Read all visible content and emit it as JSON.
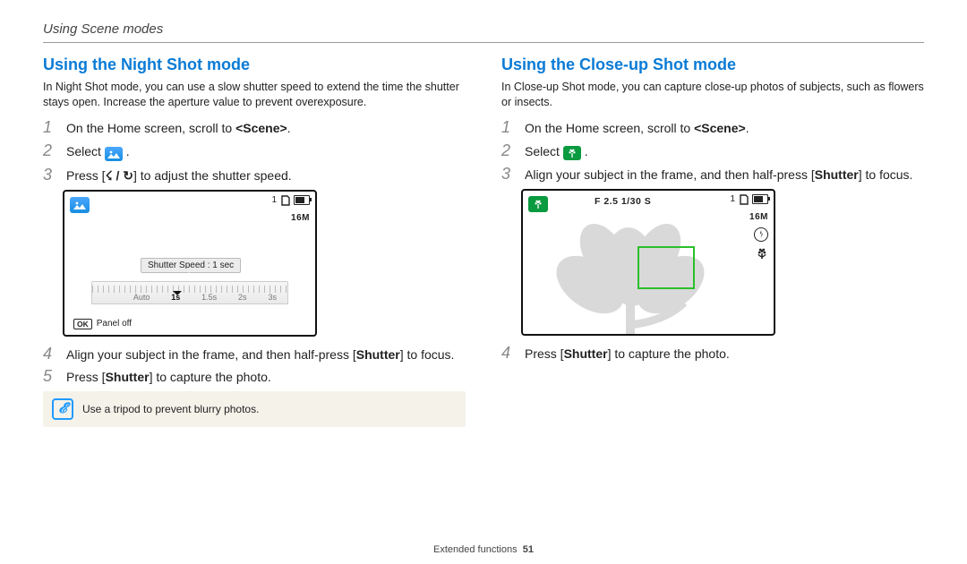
{
  "chapter": "Using Scene modes",
  "footer": {
    "section": "Extended functions",
    "page": "51"
  },
  "left": {
    "heading": "Using the Night Shot mode",
    "intro": "In Night Shot mode, you can use a slow shutter speed to extend the time the shutter stays open. Increase the aperture value to prevent overexposure.",
    "s1a": "On the Home screen, scroll to ",
    "s1b": "<Scene>",
    "s1c": ".",
    "s2a": "Select ",
    "s2c": " .",
    "s3a": "Press [",
    "s3b": "] to adjust the shutter speed.",
    "flash_timer": "☇ / ↻",
    "scr": {
      "topbar_count": "1",
      "res": "16M",
      "tooltip": "Shutter Speed : 1 sec",
      "ruler": [
        "Auto",
        "1s",
        "1.5s",
        "2s",
        "3s"
      ],
      "ok": "OK",
      "okLabel": "Panel off"
    },
    "s4a": "Align your subject in the frame, and then half-press [",
    "s4b": "Shutter",
    "s4c": "] to focus.",
    "s5a": "Press [",
    "s5b": "Shutter",
    "s5c": "] to capture the photo.",
    "tip": "Use a tripod to prevent blurry photos."
  },
  "right": {
    "heading": "Using the Close-up Shot mode",
    "intro": "In Close-up Shot mode, you can capture close-up photos of subjects, such as flowers or insects.",
    "s1a": "On the Home screen, scroll to ",
    "s1b": "<Scene>",
    "s1c": ".",
    "s2a": "Select ",
    "s2c": " .",
    "s3a": "Align your subject in the frame, and then half-press [",
    "s3b": "Shutter",
    "s3c": "] to focus.",
    "scr": {
      "topbar_count": "1",
      "res": "16M",
      "aperture": "F 2.5  1/30 S"
    },
    "s4a": "Press [",
    "s4b": "Shutter",
    "s4c": "] to capture the photo."
  }
}
